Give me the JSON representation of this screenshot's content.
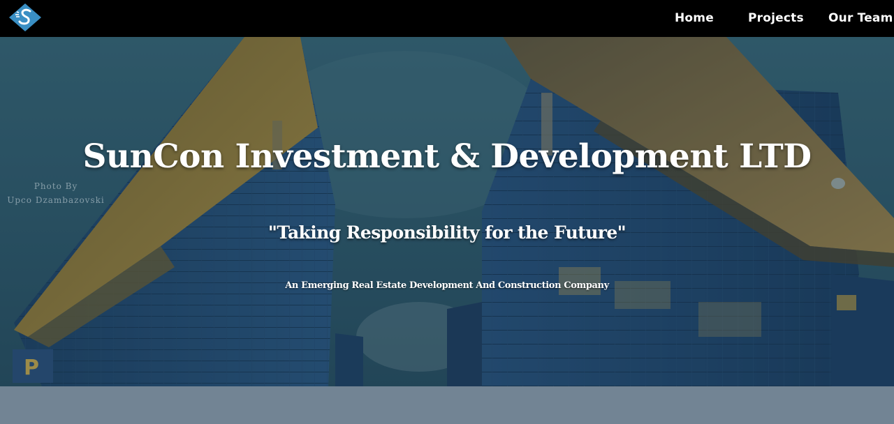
{
  "brand": {
    "logo_icon": "suncon-diamond-logo-icon",
    "logo_color": "#3a8fc4"
  },
  "nav": {
    "items": [
      {
        "label": "Home"
      },
      {
        "label": "Projects"
      },
      {
        "label": "Our Team"
      }
    ]
  },
  "hero": {
    "title": "SunCon Investment & Development LTD",
    "tagline": "\"Taking Responsibility for the Future\"",
    "subtitle": "An Emerging Real Estate Development And Construction Company",
    "photo_credit_line1": "Photo By",
    "photo_credit_line2": "Upco Dzambazovski"
  },
  "colors": {
    "navbar": "#000000",
    "footer_band": "#728494",
    "text": "#ffffff"
  }
}
